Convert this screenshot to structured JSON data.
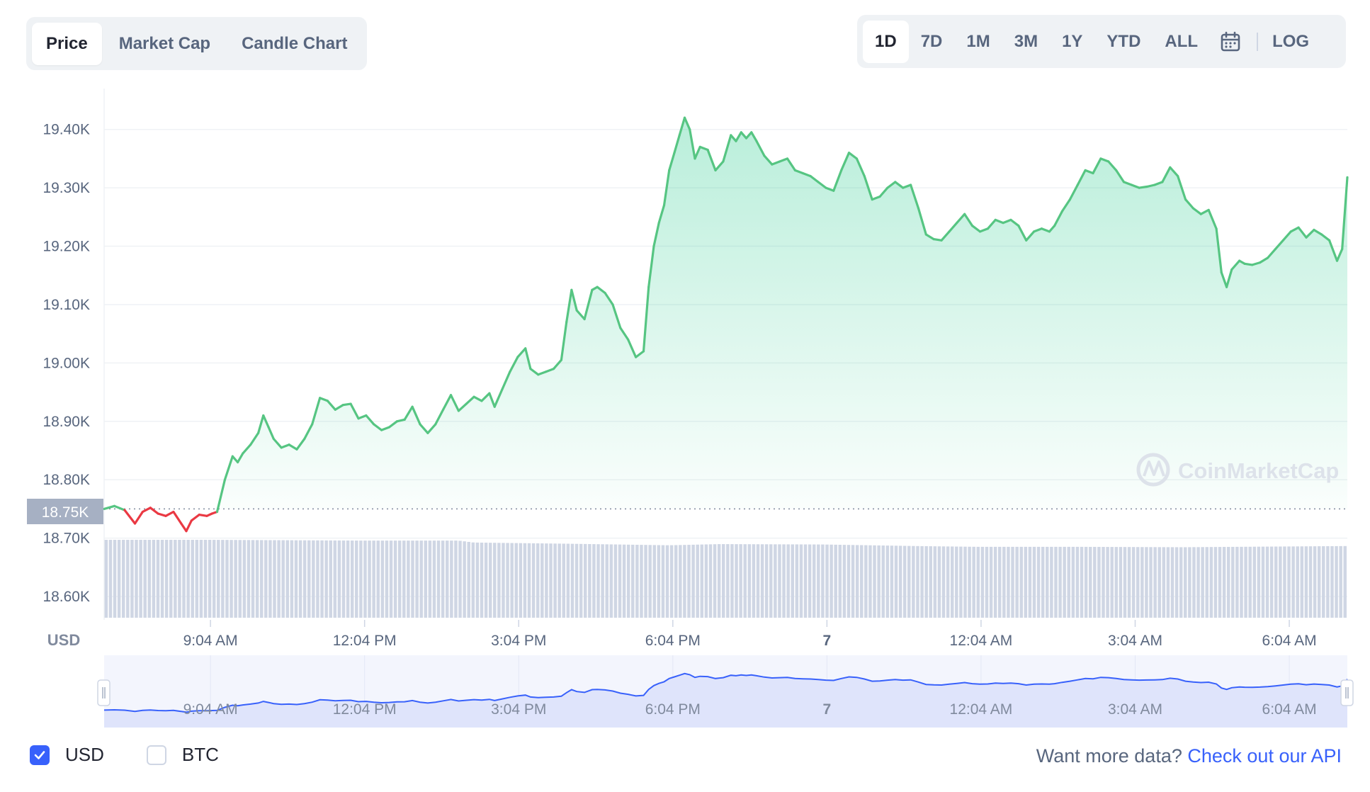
{
  "tabs": [
    {
      "label": "Price",
      "active": true
    },
    {
      "label": "Market Cap",
      "active": false
    },
    {
      "label": "Candle Chart",
      "active": false
    }
  ],
  "ranges": [
    {
      "label": "1D",
      "active": true
    },
    {
      "label": "7D",
      "active": false
    },
    {
      "label": "1M",
      "active": false
    },
    {
      "label": "3M",
      "active": false
    },
    {
      "label": "1Y",
      "active": false
    },
    {
      "label": "YTD",
      "active": false
    },
    {
      "label": "ALL",
      "active": false
    }
  ],
  "log_label": "LOG",
  "currency_toggles": [
    {
      "label": "USD",
      "checked": true
    },
    {
      "label": "BTC",
      "checked": false
    }
  ],
  "api_prompt": "Want more data?",
  "api_link": "Check out our API",
  "watermark": "CoinMarketCap",
  "colors": {
    "up": "#16c784",
    "up_line": "#56c582",
    "down": "#ea3943",
    "accent": "#3861fb",
    "volume": "#cfd6e4",
    "navigator": "#dfe4fb"
  },
  "chart_data": {
    "type": "area",
    "currency_label": "USD",
    "open_price_label": "18.75K",
    "open_price": 18750,
    "ylim": [
      18560,
      19470
    ],
    "y_ticks": [
      "18.60K",
      "18.70K",
      "18.80K",
      "18.90K",
      "19.00K",
      "19.10K",
      "19.20K",
      "19.30K",
      "19.40K"
    ],
    "y_tick_values": [
      18600,
      18700,
      18800,
      18900,
      19000,
      19100,
      19200,
      19300,
      19400
    ],
    "x_range_hours": [
      7.0,
      31.2
    ],
    "x_ticks": [
      {
        "label": "9:04 AM",
        "hour": 9.07,
        "bold": false
      },
      {
        "label": "12:04 PM",
        "hour": 12.07,
        "bold": false
      },
      {
        "label": "3:04 PM",
        "hour": 15.07,
        "bold": false
      },
      {
        "label": "6:04 PM",
        "hour": 18.07,
        "bold": false
      },
      {
        "label": "7",
        "hour": 21.07,
        "bold": true
      },
      {
        "label": "12:04 AM",
        "hour": 24.07,
        "bold": false
      },
      {
        "label": "3:04 AM",
        "hour": 27.07,
        "bold": false
      },
      {
        "label": "6:04 AM",
        "hour": 30.07,
        "bold": false
      }
    ],
    "series": [
      {
        "points": [
          [
            7.0,
            18750
          ],
          [
            7.2,
            18755
          ],
          [
            7.4,
            18748
          ],
          [
            7.6,
            18725
          ],
          [
            7.75,
            18745
          ],
          [
            7.9,
            18752
          ],
          [
            8.05,
            18742
          ],
          [
            8.2,
            18738
          ],
          [
            8.35,
            18745
          ],
          [
            8.5,
            18725
          ],
          [
            8.6,
            18712
          ],
          [
            8.7,
            18730
          ],
          [
            8.85,
            18740
          ],
          [
            9.0,
            18738
          ],
          [
            9.1,
            18742
          ],
          [
            9.2,
            18745
          ],
          [
            9.35,
            18800
          ],
          [
            9.5,
            18840
          ],
          [
            9.6,
            18830
          ],
          [
            9.7,
            18845
          ],
          [
            9.85,
            18860
          ],
          [
            10.0,
            18880
          ],
          [
            10.1,
            18910
          ],
          [
            10.2,
            18890
          ],
          [
            10.3,
            18870
          ],
          [
            10.45,
            18855
          ],
          [
            10.6,
            18860
          ],
          [
            10.75,
            18852
          ],
          [
            10.9,
            18870
          ],
          [
            11.05,
            18895
          ],
          [
            11.2,
            18940
          ],
          [
            11.35,
            18935
          ],
          [
            11.5,
            18920
          ],
          [
            11.65,
            18928
          ],
          [
            11.8,
            18930
          ],
          [
            11.95,
            18905
          ],
          [
            12.1,
            18910
          ],
          [
            12.25,
            18895
          ],
          [
            12.4,
            18885
          ],
          [
            12.55,
            18890
          ],
          [
            12.7,
            18900
          ],
          [
            12.85,
            18903
          ],
          [
            13.0,
            18925
          ],
          [
            13.15,
            18895
          ],
          [
            13.3,
            18880
          ],
          [
            13.45,
            18895
          ],
          [
            13.6,
            18920
          ],
          [
            13.75,
            18945
          ],
          [
            13.9,
            18918
          ],
          [
            14.05,
            18930
          ],
          [
            14.2,
            18942
          ],
          [
            14.35,
            18935
          ],
          [
            14.5,
            18948
          ],
          [
            14.6,
            18925
          ],
          [
            14.75,
            18955
          ],
          [
            14.9,
            18985
          ],
          [
            15.05,
            19010
          ],
          [
            15.2,
            19025
          ],
          [
            15.3,
            18990
          ],
          [
            15.45,
            18980
          ],
          [
            15.6,
            18985
          ],
          [
            15.75,
            18990
          ],
          [
            15.9,
            19005
          ],
          [
            16.0,
            19070
          ],
          [
            16.1,
            19125
          ],
          [
            16.2,
            19090
          ],
          [
            16.35,
            19075
          ],
          [
            16.5,
            19125
          ],
          [
            16.6,
            19130
          ],
          [
            16.75,
            19120
          ],
          [
            16.9,
            19100
          ],
          [
            17.05,
            19060
          ],
          [
            17.2,
            19040
          ],
          [
            17.35,
            19010
          ],
          [
            17.5,
            19020
          ],
          [
            17.6,
            19130
          ],
          [
            17.7,
            19200
          ],
          [
            17.8,
            19240
          ],
          [
            17.9,
            19270
          ],
          [
            18.0,
            19330
          ],
          [
            18.1,
            19360
          ],
          [
            18.2,
            19390
          ],
          [
            18.3,
            19420
          ],
          [
            18.4,
            19400
          ],
          [
            18.5,
            19350
          ],
          [
            18.6,
            19370
          ],
          [
            18.75,
            19365
          ],
          [
            18.9,
            19330
          ],
          [
            19.05,
            19345
          ],
          [
            19.2,
            19390
          ],
          [
            19.3,
            19380
          ],
          [
            19.4,
            19395
          ],
          [
            19.5,
            19385
          ],
          [
            19.6,
            19395
          ],
          [
            19.7,
            19380
          ],
          [
            19.85,
            19355
          ],
          [
            20.0,
            19340
          ],
          [
            20.15,
            19345
          ],
          [
            20.3,
            19350
          ],
          [
            20.45,
            19330
          ],
          [
            20.6,
            19325
          ],
          [
            20.75,
            19320
          ],
          [
            20.9,
            19310
          ],
          [
            21.05,
            19300
          ],
          [
            21.2,
            19295
          ],
          [
            21.35,
            19330
          ],
          [
            21.5,
            19360
          ],
          [
            21.65,
            19350
          ],
          [
            21.8,
            19320
          ],
          [
            21.95,
            19280
          ],
          [
            22.1,
            19285
          ],
          [
            22.25,
            19300
          ],
          [
            22.4,
            19310
          ],
          [
            22.55,
            19300
          ],
          [
            22.7,
            19305
          ],
          [
            22.85,
            19265
          ],
          [
            23.0,
            19220
          ],
          [
            23.15,
            19212
          ],
          [
            23.3,
            19210
          ],
          [
            23.45,
            19225
          ],
          [
            23.6,
            19240
          ],
          [
            23.75,
            19255
          ],
          [
            23.9,
            19235
          ],
          [
            24.05,
            19225
          ],
          [
            24.2,
            19230
          ],
          [
            24.35,
            19245
          ],
          [
            24.5,
            19240
          ],
          [
            24.65,
            19245
          ],
          [
            24.8,
            19235
          ],
          [
            24.95,
            19210
          ],
          [
            25.1,
            19225
          ],
          [
            25.25,
            19230
          ],
          [
            25.4,
            19225
          ],
          [
            25.5,
            19235
          ],
          [
            25.65,
            19260
          ],
          [
            25.8,
            19280
          ],
          [
            25.95,
            19305
          ],
          [
            26.1,
            19330
          ],
          [
            26.25,
            19325
          ],
          [
            26.4,
            19350
          ],
          [
            26.55,
            19345
          ],
          [
            26.7,
            19330
          ],
          [
            26.85,
            19310
          ],
          [
            27.0,
            19305
          ],
          [
            27.15,
            19300
          ],
          [
            27.3,
            19302
          ],
          [
            27.45,
            19305
          ],
          [
            27.6,
            19310
          ],
          [
            27.75,
            19335
          ],
          [
            27.9,
            19320
          ],
          [
            28.05,
            19280
          ],
          [
            28.2,
            19265
          ],
          [
            28.35,
            19255
          ],
          [
            28.5,
            19262
          ],
          [
            28.65,
            19230
          ],
          [
            28.75,
            19155
          ],
          [
            28.85,
            19130
          ],
          [
            28.95,
            19160
          ],
          [
            29.1,
            19175
          ],
          [
            29.2,
            19170
          ],
          [
            29.35,
            19168
          ],
          [
            29.5,
            19172
          ],
          [
            29.65,
            19180
          ],
          [
            29.8,
            19195
          ],
          [
            29.95,
            19210
          ],
          [
            30.1,
            19225
          ],
          [
            30.25,
            19232
          ],
          [
            30.4,
            19215
          ],
          [
            30.55,
            19228
          ],
          [
            30.7,
            19220
          ],
          [
            30.85,
            19210
          ],
          [
            31.0,
            19175
          ],
          [
            31.1,
            19195
          ],
          [
            31.2,
            19318
          ]
        ]
      }
    ],
    "volume": [
      [
        7.0,
        1.0
      ],
      [
        9.0,
        1.0
      ],
      [
        12.0,
        0.99
      ],
      [
        13.9,
        0.99
      ],
      [
        14.2,
        0.965
      ],
      [
        16.0,
        0.95
      ],
      [
        18.0,
        0.93
      ],
      [
        19.0,
        0.945
      ],
      [
        21.0,
        0.94
      ],
      [
        22.8,
        0.92
      ],
      [
        24.0,
        0.91
      ],
      [
        26.0,
        0.91
      ],
      [
        28.0,
        0.905
      ],
      [
        31.2,
        0.92
      ]
    ]
  }
}
